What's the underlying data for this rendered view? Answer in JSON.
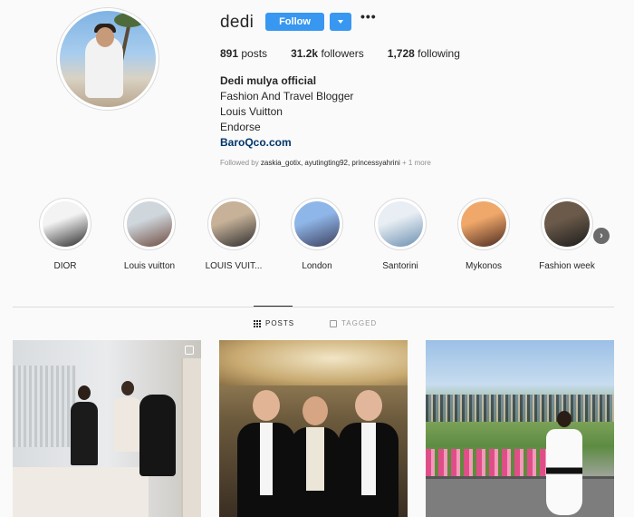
{
  "profile": {
    "username": "dedi",
    "follow_label": "Follow",
    "more_label": "•••",
    "stats": {
      "posts_count": "891",
      "posts_label": "posts",
      "followers_count": "31.2k",
      "followers_label": "followers",
      "following_count": "1,728",
      "following_label": "following"
    },
    "full_name": "Dedi mulya official",
    "bio_lines": [
      "Fashion And Travel Blogger",
      "Louis Vuitton",
      "Endorse"
    ],
    "website": "BaroQco.com",
    "followed_by_prefix": "Followed by ",
    "followed_by_users": "zaskia_gotix, ayutingting92, princessyahrini",
    "followed_by_more": " + 1 more"
  },
  "highlights": [
    {
      "label": "DIOR",
      "color_a": "#f3f3f3",
      "color_b": "#2a2a2a"
    },
    {
      "label": "Louis vuitton",
      "color_a": "#cfd7dd",
      "color_b": "#6e4a3e"
    },
    {
      "label": "LOUIS VUIT...",
      "color_a": "#c7b299",
      "color_b": "#2d2d2d"
    },
    {
      "label": "London",
      "color_a": "#8fb6e8",
      "color_b": "#3b3f5c"
    },
    {
      "label": "Santorini",
      "color_a": "#e8eef3",
      "color_b": "#6a8eb0"
    },
    {
      "label": "Mykonos",
      "color_a": "#f0a86a",
      "color_b": "#4a2a20"
    },
    {
      "label": "Fashion week",
      "color_a": "#6b5a4a",
      "color_b": "#1c1c1c"
    }
  ],
  "tabs": {
    "posts_label": "POSTS",
    "tagged_label": "TAGGED"
  },
  "colors": {
    "accent": "#3897f0",
    "link": "#003569",
    "muted": "#8e8e8e",
    "border": "#dbdbdb",
    "background": "#fafafa"
  }
}
